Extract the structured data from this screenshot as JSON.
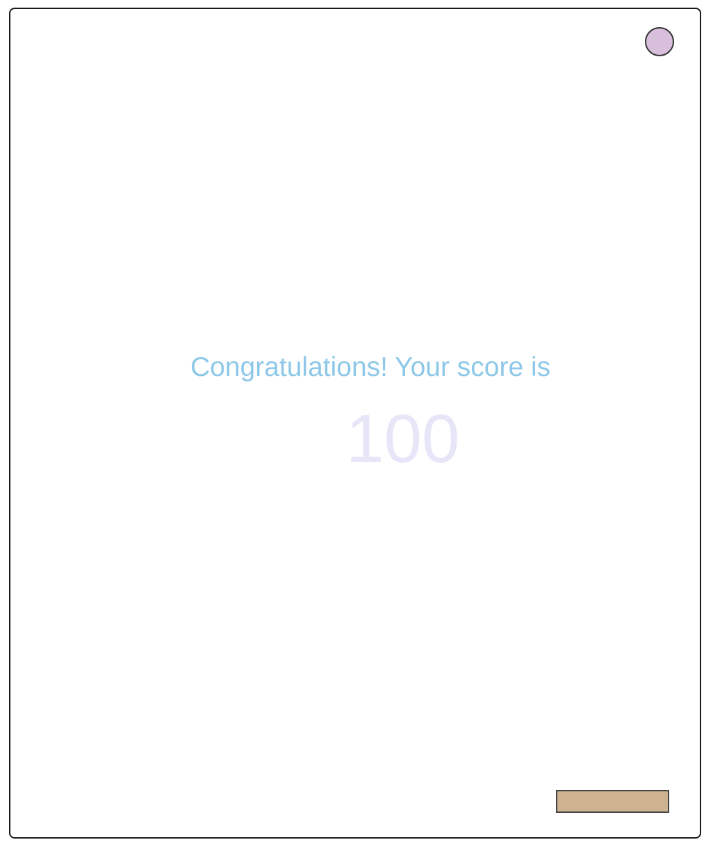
{
  "game": {
    "message": "Congratulations! Your score is",
    "score": "100"
  },
  "colors": {
    "ball": "#d8c0dc",
    "paddle": "#cdb390",
    "message": "#8ec8e8",
    "score": "#e6e6f8",
    "border": "#1a1a1a"
  }
}
